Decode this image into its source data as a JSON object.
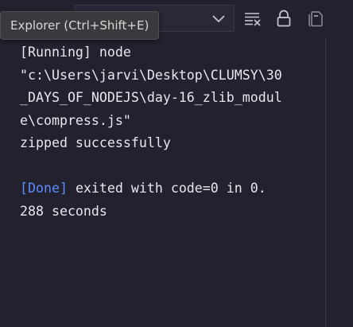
{
  "tooltip": {
    "text": "Explorer (Ctrl+Shift+E)"
  },
  "toolbar": {
    "dropdown_value": "",
    "icons": [
      "chevron-down-icon",
      "clear-output-icon",
      "lock-icon",
      "copy-icon"
    ]
  },
  "output": {
    "lines": [
      "[Running] node",
      "\"c:\\Users\\jarvi\\Desktop\\CLUMSY\\30",
      "_DAYS_OF_NODEJS\\day-16_zlib_modul",
      "e\\compress.js\"",
      "zipped successfully"
    ],
    "done_tag": "[Done]",
    "done_rest": " exited with code=0 in 0.",
    "done_line2": "288 seconds"
  },
  "colors": {
    "background": "#24212e",
    "text": "#e8e6ef",
    "done_tag": "#5b8dff",
    "icon": "#c9c6d3"
  }
}
